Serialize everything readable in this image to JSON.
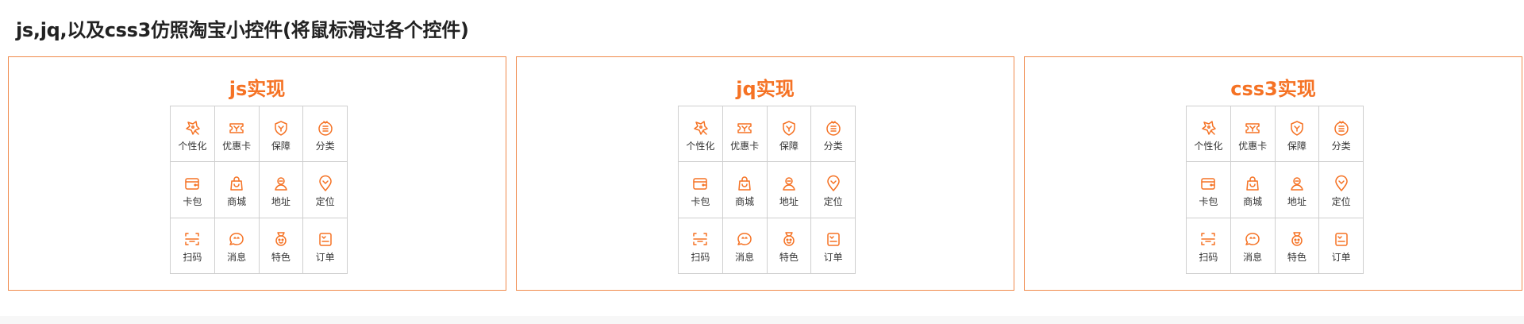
{
  "page": {
    "title": "js,jq,以及css3仿照淘宝小控件(将鼠标滑过各个控件)"
  },
  "accent_color": "#f57224",
  "panels": [
    {
      "title": "js实现",
      "items": [
        {
          "label": "个性化",
          "icon": "personalize-icon"
        },
        {
          "label": "优惠卡",
          "icon": "coupon-icon"
        },
        {
          "label": "保障",
          "icon": "shield-icon"
        },
        {
          "label": "分类",
          "icon": "category-icon"
        },
        {
          "label": "卡包",
          "icon": "wallet-icon"
        },
        {
          "label": "商城",
          "icon": "shopping-bag-icon"
        },
        {
          "label": "地址",
          "icon": "address-icon"
        },
        {
          "label": "定位",
          "icon": "location-icon"
        },
        {
          "label": "扫码",
          "icon": "scan-icon"
        },
        {
          "label": "消息",
          "icon": "message-icon"
        },
        {
          "label": "特色",
          "icon": "medal-icon"
        },
        {
          "label": "订单",
          "icon": "order-icon"
        }
      ]
    },
    {
      "title": "jq实现",
      "items": [
        {
          "label": "个性化",
          "icon": "personalize-icon"
        },
        {
          "label": "优惠卡",
          "icon": "coupon-icon"
        },
        {
          "label": "保障",
          "icon": "shield-icon"
        },
        {
          "label": "分类",
          "icon": "category-icon"
        },
        {
          "label": "卡包",
          "icon": "wallet-icon"
        },
        {
          "label": "商城",
          "icon": "shopping-bag-icon"
        },
        {
          "label": "地址",
          "icon": "address-icon"
        },
        {
          "label": "定位",
          "icon": "location-icon"
        },
        {
          "label": "扫码",
          "icon": "scan-icon"
        },
        {
          "label": "消息",
          "icon": "message-icon"
        },
        {
          "label": "特色",
          "icon": "medal-icon"
        },
        {
          "label": "订单",
          "icon": "order-icon"
        }
      ]
    },
    {
      "title": "css3实现",
      "items": [
        {
          "label": "个性化",
          "icon": "personalize-icon"
        },
        {
          "label": "优惠卡",
          "icon": "coupon-icon"
        },
        {
          "label": "保障",
          "icon": "shield-icon"
        },
        {
          "label": "分类",
          "icon": "category-icon"
        },
        {
          "label": "卡包",
          "icon": "wallet-icon"
        },
        {
          "label": "商城",
          "icon": "shopping-bag-icon"
        },
        {
          "label": "地址",
          "icon": "address-icon"
        },
        {
          "label": "定位",
          "icon": "location-icon"
        },
        {
          "label": "扫码",
          "icon": "scan-icon"
        },
        {
          "label": "消息",
          "icon": "message-icon"
        },
        {
          "label": "特色",
          "icon": "medal-icon"
        },
        {
          "label": "订单",
          "icon": "order-icon"
        }
      ]
    }
  ]
}
